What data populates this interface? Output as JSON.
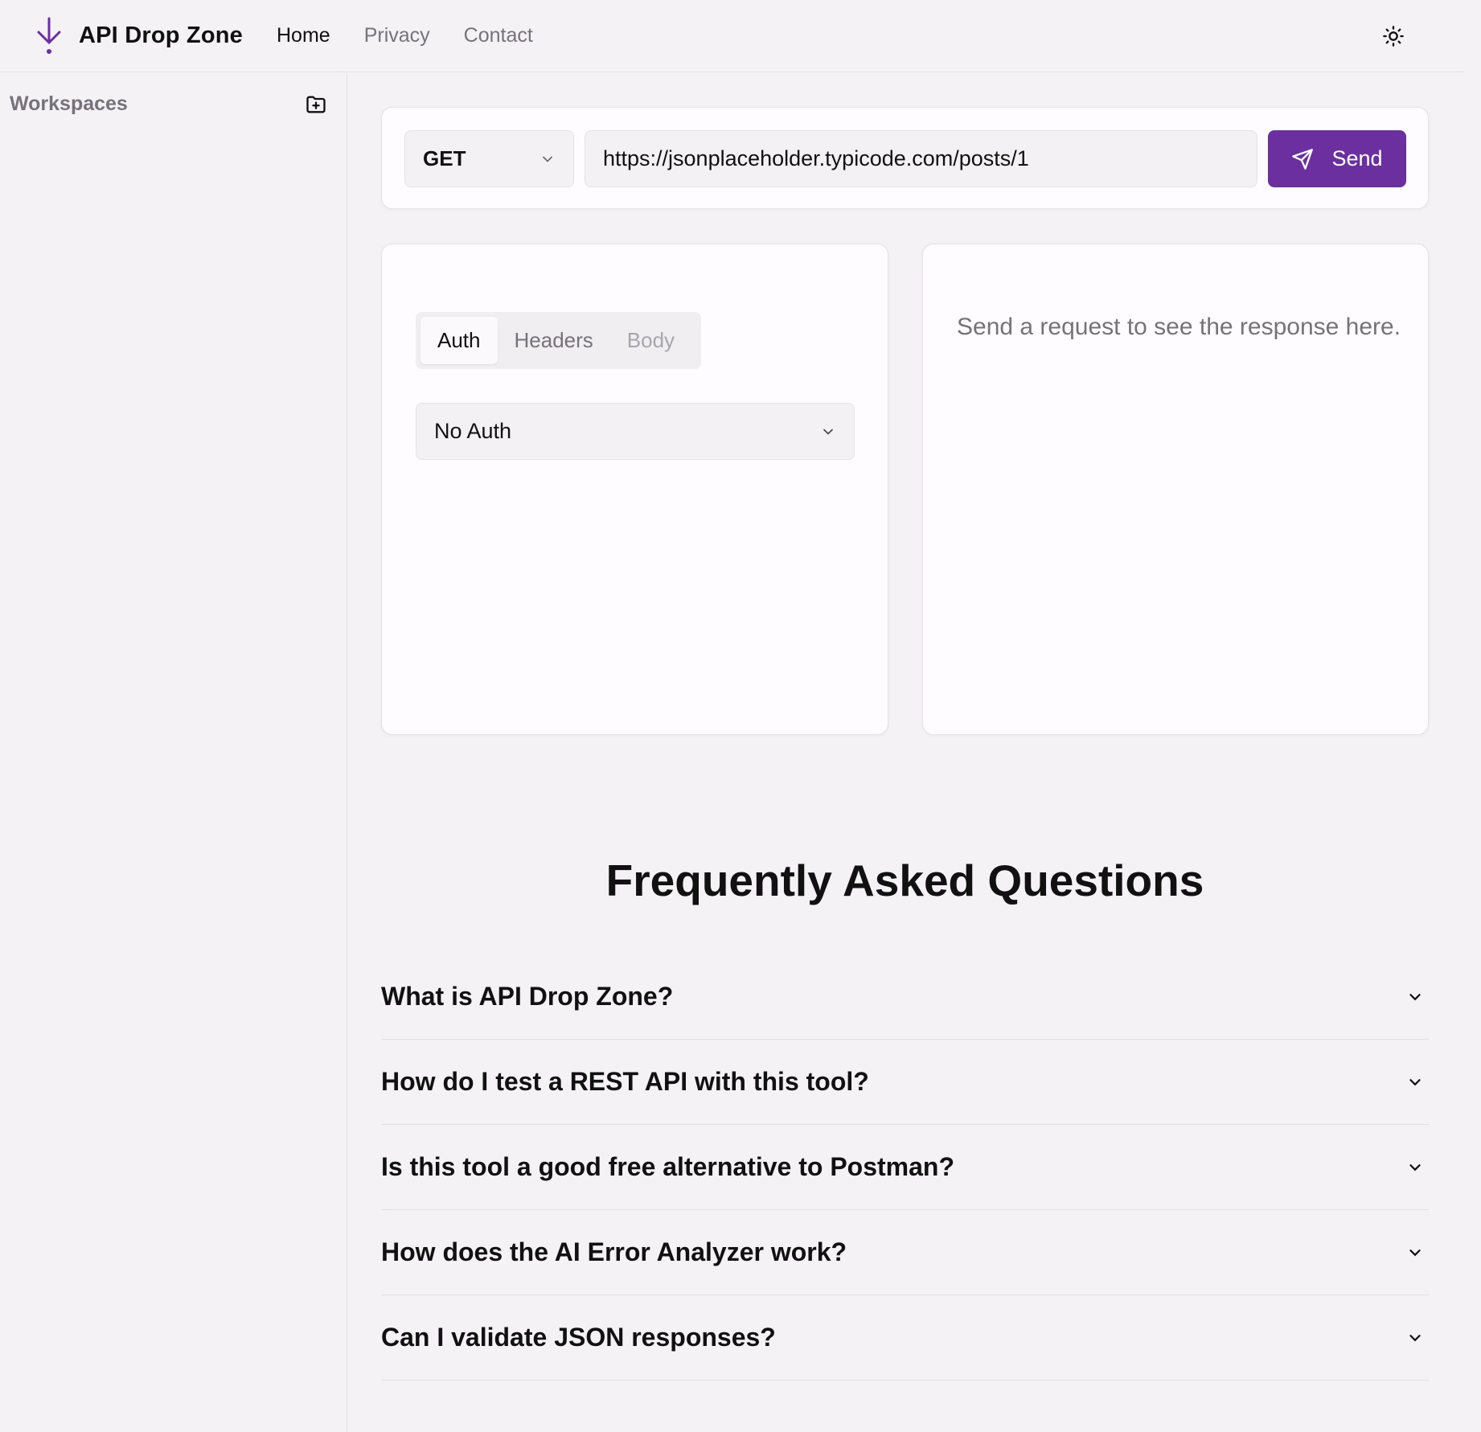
{
  "header": {
    "brand_name": "API Drop Zone",
    "brand_icon": "arrow-down-icon",
    "brand_color": "#6b2fa0",
    "nav": [
      {
        "label": "Home",
        "active": true
      },
      {
        "label": "Privacy",
        "active": false
      },
      {
        "label": "Contact",
        "active": false
      }
    ],
    "theme_icon": "sun-icon"
  },
  "sidebar": {
    "title": "Workspaces",
    "add_icon": "folder-plus-icon"
  },
  "request": {
    "method": "GET",
    "url": "https://jsonplaceholder.typicode.com/posts/1",
    "send_label": "Send",
    "send_icon": "paper-plane-icon",
    "tabs": [
      {
        "label": "Auth",
        "state": "active"
      },
      {
        "label": "Headers",
        "state": "normal"
      },
      {
        "label": "Body",
        "state": "disabled"
      }
    ],
    "auth_type": "No Auth"
  },
  "response": {
    "placeholder": "Send a request to see the response here."
  },
  "faq": {
    "title": "Frequently Asked Questions",
    "items": [
      "What is API Drop Zone?",
      "How do I test a REST API with this tool?",
      "Is this tool a good free alternative to Postman?",
      "How does the AI Error Analyzer work?",
      "Can I validate JSON responses?"
    ]
  }
}
